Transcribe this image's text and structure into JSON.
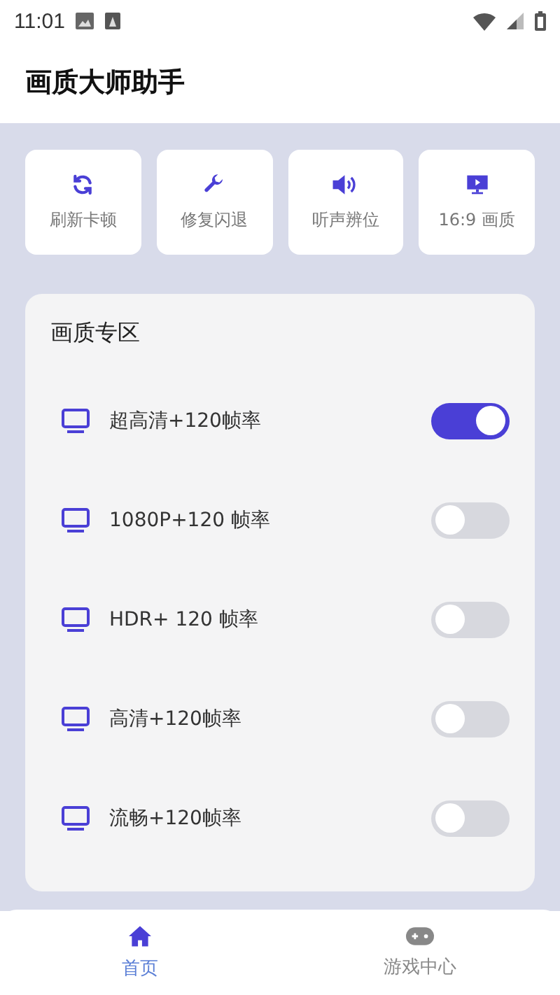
{
  "status_bar": {
    "time": "11:01"
  },
  "app_bar": {
    "title": "画质大师助手"
  },
  "quick_actions": [
    {
      "kind": "refresh",
      "label": "刷新卡顿"
    },
    {
      "kind": "wrench",
      "label": "修复闪退"
    },
    {
      "kind": "speaker",
      "label": "听声辨位"
    },
    {
      "kind": "monitor",
      "label": "16:9 画质"
    }
  ],
  "quality_panel": {
    "title": "画质专区",
    "options": [
      {
        "label": "超高清+120帧率",
        "on": true
      },
      {
        "label": "1080P+120 帧率",
        "on": false
      },
      {
        "label": "HDR+ 120 帧率",
        "on": false
      },
      {
        "label": "高清+120帧率",
        "on": false
      },
      {
        "label": "流畅+120帧率",
        "on": false
      }
    ]
  },
  "bottom_nav": [
    {
      "kind": "home",
      "label": "首页",
      "selected": true
    },
    {
      "kind": "gamepad",
      "label": "游戏中心",
      "selected": false
    }
  ]
}
